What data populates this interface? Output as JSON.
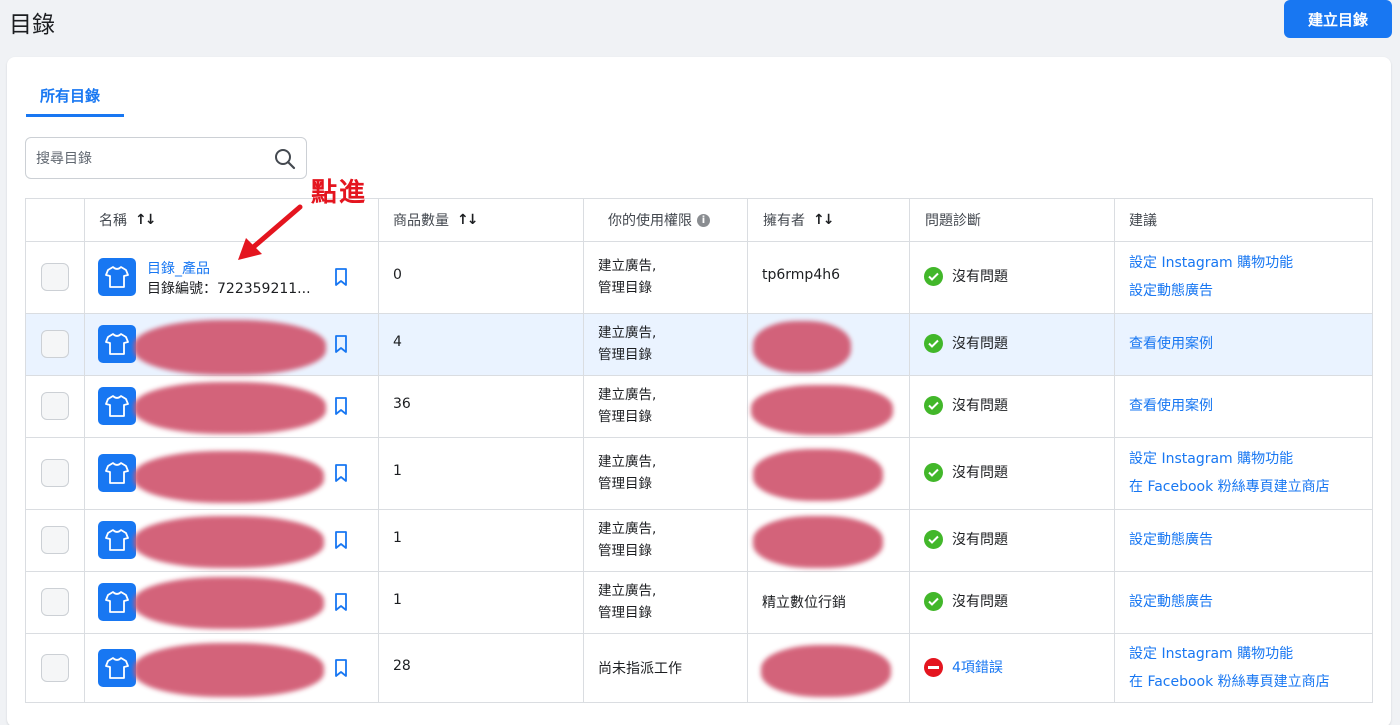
{
  "header": {
    "title": "目錄",
    "create_button": "建立目錄"
  },
  "tabs": [
    {
      "label": "所有目錄",
      "active": true
    }
  ],
  "search": {
    "placeholder": "搜尋目錄"
  },
  "annotation": {
    "text": "點進",
    "color": "#e4151f"
  },
  "table": {
    "columns": {
      "name": "名稱",
      "count": "商品數量",
      "permission": "你的使用權限",
      "owner": "擁有者",
      "diagnosis": "問題診斷",
      "suggestion": "建議"
    },
    "rows": [
      {
        "name": "目錄_產品",
        "id_label": "目錄編號：722359211...",
        "count": "0",
        "perm1": "建立廣告,",
        "perm2": "管理目錄",
        "owner": "tp6rmp4h6",
        "status": "沒有問題",
        "status_type": "ok",
        "sugg1": "設定 Instagram 購物功能",
        "sugg2": "設定動態廣告"
      },
      {
        "name": "",
        "id_label": "",
        "count": "4",
        "perm1": "建立廣告,",
        "perm2": "管理目錄",
        "owner": "",
        "status": "沒有問題",
        "status_type": "ok",
        "sugg1": "查看使用案例",
        "sugg2": ""
      },
      {
        "name": "",
        "id_label": "",
        "count": "36",
        "perm1": "建立廣告,",
        "perm2": "管理目錄",
        "owner": "",
        "status": "沒有問題",
        "status_type": "ok",
        "sugg1": "查看使用案例",
        "sugg2": ""
      },
      {
        "name": "",
        "id_label": "",
        "count": "1",
        "perm1": "建立廣告,",
        "perm2": "管理目錄",
        "owner": "",
        "status": "沒有問題",
        "status_type": "ok",
        "sugg1": "設定 Instagram 購物功能",
        "sugg2": "在 Facebook 粉絲專頁建立商店"
      },
      {
        "name": "",
        "id_label": "",
        "count": "1",
        "perm1": "建立廣告,",
        "perm2": "管理目錄",
        "owner": "",
        "status": "沒有問題",
        "status_type": "ok",
        "sugg1": "設定動態廣告",
        "sugg2": ""
      },
      {
        "name": "",
        "id_label": "",
        "count": "1",
        "perm1": "建立廣告,",
        "perm2": "管理目錄",
        "owner": "精立數位行銷",
        "status": "沒有問題",
        "status_type": "ok",
        "sugg1": "設定動態廣告",
        "sugg2": ""
      },
      {
        "name": "",
        "id_label": "",
        "count": "28",
        "perm1": "尚未指派工作",
        "perm2": "",
        "owner": "",
        "status": "4項錯誤",
        "status_type": "error",
        "sugg1": "設定 Instagram 購物功能",
        "sugg2": "在 Facebook 粉絲專頁建立商店"
      }
    ]
  }
}
